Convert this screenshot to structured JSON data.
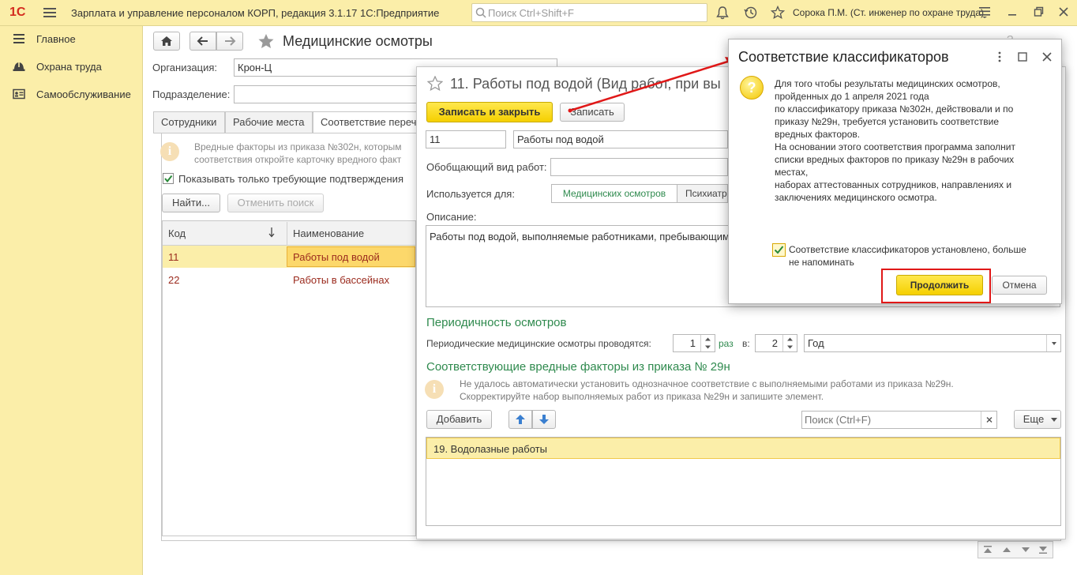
{
  "topbar": {
    "logo": "1С",
    "app_title": "Зарплата и управление персоналом КОРП, редакция 3.1.17 1С:Предприятие",
    "search_placeholder": "Поиск Ctrl+Shift+F",
    "user": "Сорока П.М. (Ст. инженер по охране труда)"
  },
  "sidebar": {
    "items": [
      {
        "label": "Главное",
        "icon": "menu-lines-icon"
      },
      {
        "label": "Охрана труда",
        "icon": "helmet-icon"
      },
      {
        "label": "Самообслуживание",
        "icon": "id-card-icon"
      }
    ]
  },
  "main": {
    "title": "Медицинские осмотры",
    "org_label": "Организация:",
    "org_value": "Крон-Ц",
    "dept_label": "Подразделение:",
    "dept_value": "",
    "tabs": [
      "Сотрудники",
      "Рабочие места",
      "Соответствие переч"
    ],
    "info_line1": "Вредные факторы из приказа №302н, которым",
    "info_line2": "соответствия откройте карточку вредного факт",
    "show_only_label": "Показывать только требующие подтверждения",
    "find_button": "Найти...",
    "cancel_search_button": "Отменить поиск",
    "columns": [
      "Код",
      "Наименование"
    ],
    "rows": [
      {
        "code": "11",
        "name": "Работы под водой"
      },
      {
        "code": "22",
        "name": "Работы в бассейнах"
      }
    ]
  },
  "element_form": {
    "title": "11. Работы под водой (Вид работ, при вы",
    "save_close_button": "Записать и закрыть",
    "save_button": "Записать",
    "code": "11",
    "name": "Работы под водой",
    "generic_label": "Обобщающий вид работ:",
    "generic_value": "",
    "used_for_label": "Используется для:",
    "used_for_tabs": [
      "Медицинских осмотров",
      "Психиатр"
    ],
    "description_label": "Описание:",
    "description": "Работы под водой, выполняемые работниками, пребывающим",
    "periodicity_title": "Периодичность осмотров",
    "periodicity_label": "Периодические медицинские осмотры проводятся:",
    "times_value": "1",
    "times_label": "раз",
    "in_label": "в:",
    "period_count": "2",
    "period_unit": "Год",
    "factors_title": "Соответствующие вредные факторы из приказа № 29н",
    "factors_hint_line1": "Не удалось автоматически установить однозначное соответствие с выполняемыми работами из приказа №29н.",
    "factors_hint_line2": "Скорректируйте набор выполняемых работ из приказа №29н и запишите элемент.",
    "add_button": "Добавить",
    "search_placeholder": "Поиск (Ctrl+F)",
    "more_button": "Еще",
    "factors": [
      "19. Водолазные работы"
    ]
  },
  "dialog": {
    "title": "Соответствие классификаторов",
    "text": "Для того чтобы результаты медицинских осмотров,\nпройденных до 1 апреля 2021 года\nпо классификатору приказа №302н, действовали и по\nприказу №29н, требуется установить соответствие\nвредных факторов.\nНа основании этого соответствия программа заполнит\nсписки вредных факторов по приказу №29н в рабочих\nместах,\nнаборах аттестованных сотрудников, направлениях и\nзаключениях медицинского осмотра.",
    "checkbox_label_line1": "Соответствие классификаторов установлено, больше",
    "checkbox_label_line2": "не напоминать",
    "continue_button": "Продолжить",
    "cancel_button": "Отмена",
    "question_icon": "?"
  },
  "colors": {
    "panel_yellow": "#fbeea9",
    "button_yellow": "#f5d000",
    "green_title": "#2f8a4e",
    "red_text": "#9b2b1e",
    "highlight_red": "#e01818"
  }
}
